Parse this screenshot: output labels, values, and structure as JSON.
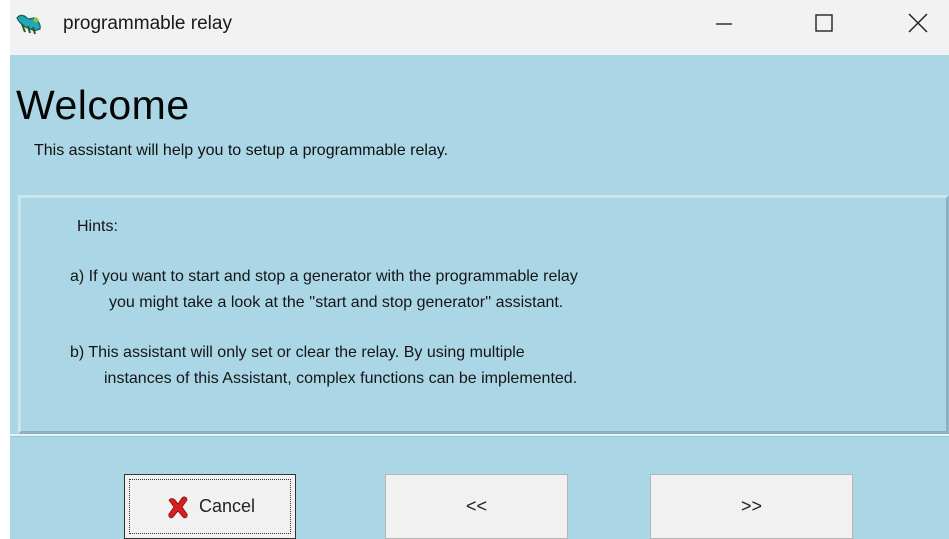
{
  "window": {
    "title": "programmable relay",
    "controls": [
      "minimize-icon",
      "maximize-icon",
      "close-icon"
    ]
  },
  "header": {
    "title": "Welcome",
    "subtitle": "This assistant will help you to setup a programmable relay."
  },
  "hints": {
    "heading": "Hints:",
    "a_line1": "a)  If you want to start and stop a generator with the programmable relay",
    "a_line2": "you might take a look at the ''start and stop generator'' assistant.",
    "b_line1": "b)  This assistant will only set or clear the relay. By using multiple",
    "b_line2": "instances of this Assistant, complex functions can be implemented."
  },
  "buttons": {
    "cancel_label": "Cancel",
    "cancel_icon": "red-x-icon",
    "prev_label": "<<",
    "next_label": ">>"
  },
  "colors": {
    "panel_background": "#aad6e6",
    "titlebar_background": "#f2f2f2",
    "cancel_icon_color": "#d81e1e",
    "button_face": "#f1f1f1"
  }
}
